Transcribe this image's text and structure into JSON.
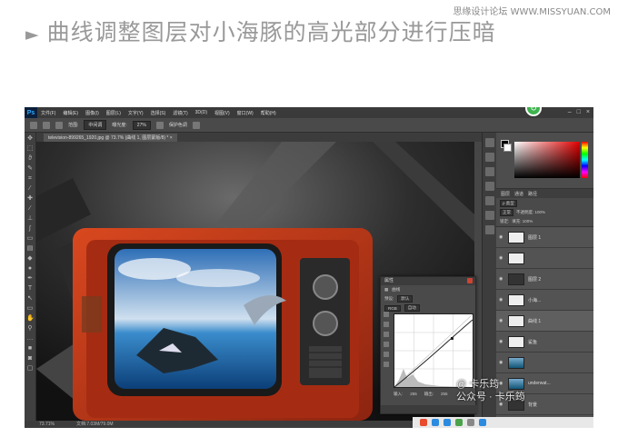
{
  "watermark": "思缘设计论坛  WWW.MISSYUAN.COM",
  "heading": {
    "marker": "►",
    "text": "曲线调整图层对小海豚的高光部分进行压暗"
  },
  "ps": {
    "logo": "Ps",
    "menus": [
      "文件(F)",
      "编辑(E)",
      "图像(I)",
      "图层(L)",
      "文字(Y)",
      "选择(S)",
      "滤镜(T)",
      "3D(D)",
      "视图(V)",
      "窗口(W)",
      "帮助(H)"
    ],
    "options": {
      "range_label": "范围:",
      "range_value": "中间调",
      "exposure_label": "曝光度:",
      "exposure_value": "27%",
      "protect_label": "保护色调"
    },
    "tab_title": "television-899265_1920.jpg @ 73.7% (曲线 1, 图层蒙版/8) *  ×",
    "status": {
      "zoom": "73.71%",
      "doc": "文档:7.03M/79.0M"
    },
    "layers": {
      "tabs": [
        "图层",
        "通道",
        "路径"
      ],
      "kind_label": "ρ 类型",
      "blend": "正常",
      "opacity": "不透明度: 100%",
      "lock": "锁定:",
      "fill": "填充: 100%",
      "items": [
        {
          "name": "图层 1",
          "thumb": "white"
        },
        {
          "name": "",
          "thumb": "white"
        },
        {
          "name": "图层 2",
          "thumb": "dark"
        },
        {
          "name": "小海...",
          "thumb": "white"
        },
        {
          "name": "曲线 1",
          "thumb": "white"
        },
        {
          "name": "鲨鱼",
          "thumb": "white"
        },
        {
          "name": "",
          "thumb": "img"
        },
        {
          "name": "underwat...",
          "thumb": "img"
        },
        {
          "name": "背景",
          "thumb": "dark"
        }
      ]
    },
    "properties": {
      "title": "属性",
      "type_label": "曲线",
      "preset_label": "预设:",
      "preset_value": "默认",
      "channel_value": "RGB",
      "auto_label": "自动",
      "input_label": "输入:",
      "input_value": "255",
      "output_label": "输出:",
      "output_value": "255"
    }
  },
  "overlay": {
    "line1": "@ 卡乐筠",
    "line2": "公众号 · 卡乐筠"
  },
  "colors": {
    "ps_bg": "#535353",
    "accent_green": "#3fb34f",
    "tv_orange": "#c4361a"
  }
}
